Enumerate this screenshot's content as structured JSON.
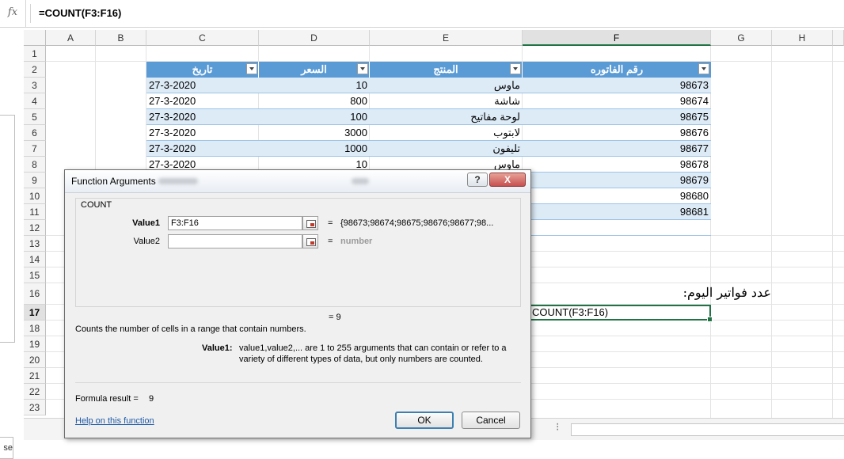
{
  "formula_bar": {
    "fx": "fx",
    "formula": "=COUNT(F3:F16)"
  },
  "columns": [
    "A",
    "B",
    "C",
    "D",
    "E",
    "F",
    "G",
    "H"
  ],
  "rows": [
    "1",
    "2",
    "3",
    "4",
    "5",
    "6",
    "7",
    "8",
    "9",
    "10",
    "11",
    "12",
    "13",
    "14",
    "15",
    "16",
    "17",
    "18",
    "19",
    "20",
    "21",
    "22",
    "23"
  ],
  "table": {
    "headers": {
      "date": "تاريخ",
      "price": "السعر",
      "product": "المنتج",
      "invoice": "رقم الفاتوره"
    },
    "rows": [
      {
        "date": "27-3-2020",
        "price": "10",
        "product": "ماوس",
        "invoice": "98673"
      },
      {
        "date": "27-3-2020",
        "price": "800",
        "product": "شاشة",
        "invoice": "98674"
      },
      {
        "date": "27-3-2020",
        "price": "100",
        "product": "لوحة مفاتيح",
        "invoice": "98675"
      },
      {
        "date": "27-3-2020",
        "price": "3000",
        "product": "لابتوب",
        "invoice": "98676"
      },
      {
        "date": "27-3-2020",
        "price": "1000",
        "product": "تليفون",
        "invoice": "98677"
      },
      {
        "date": "27-3-2020",
        "price": "10",
        "product": "ماوس",
        "invoice": "98678"
      },
      {
        "date": "",
        "price": "",
        "product": "",
        "invoice": "98679"
      },
      {
        "date": "",
        "price": "",
        "product": "",
        "invoice": "98680"
      },
      {
        "date": "",
        "price": "",
        "product": "",
        "invoice": "98681"
      }
    ]
  },
  "cells": {
    "g16_label": "عدد فواتير اليوم:",
    "active_cell_text": "COUNT(F3:F16)"
  },
  "left_pane_fragment": "se",
  "dialog": {
    "title": "Function Arguments",
    "help_label": "?",
    "close_label": "X",
    "function_name": "COUNT",
    "value1_label": "Value1",
    "value1_input": "F3:F16",
    "value1_eq": "=",
    "value1_result": "{98673;98674;98675;98676;98677;98...",
    "value2_label": "Value2",
    "value2_input": "",
    "value2_eq": "=",
    "value2_result": "number",
    "result_eq": "= 9",
    "description": "Counts the number of cells in a range that contain numbers.",
    "arg_desc_label": "Value1:",
    "arg_desc_line1": "value1,value2,... are 1 to 255 arguments that can contain or refer to a",
    "arg_desc_line2": "variety of different types of data, but only numbers are counted.",
    "formula_result_label": "Formula result =",
    "formula_result_value": "9",
    "help_link": "Help on this function",
    "ok_label": "OK",
    "cancel_label": "Cancel"
  }
}
